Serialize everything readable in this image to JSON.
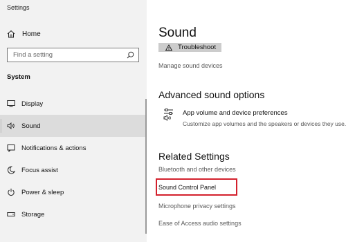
{
  "app": {
    "title": "Settings"
  },
  "nav": {
    "home_label": "Home",
    "search_placeholder": "Find a setting",
    "section_label": "System",
    "items": [
      {
        "label": "Display",
        "icon": "monitor-icon"
      },
      {
        "label": "Sound",
        "icon": "speaker-icon",
        "selected": true
      },
      {
        "label": "Notifications & actions",
        "icon": "notification-icon"
      },
      {
        "label": "Focus assist",
        "icon": "moon-icon"
      },
      {
        "label": "Power & sleep",
        "icon": "power-icon"
      },
      {
        "label": "Storage",
        "icon": "storage-icon"
      }
    ]
  },
  "main": {
    "title": "Sound",
    "troubleshoot_label": "Troubleshoot",
    "manage_link": "Manage sound devices",
    "advanced_heading": "Advanced sound options",
    "app_volume": {
      "title": "App volume and device preferences",
      "description": "Customize app volumes and the speakers or devices they use."
    },
    "related_heading": "Related Settings",
    "related_links": [
      "Bluetooth and other devices",
      "Sound Control Panel",
      "Microphone privacy settings",
      "Ease of Access audio settings"
    ],
    "highlight_color": "#d3202c"
  }
}
